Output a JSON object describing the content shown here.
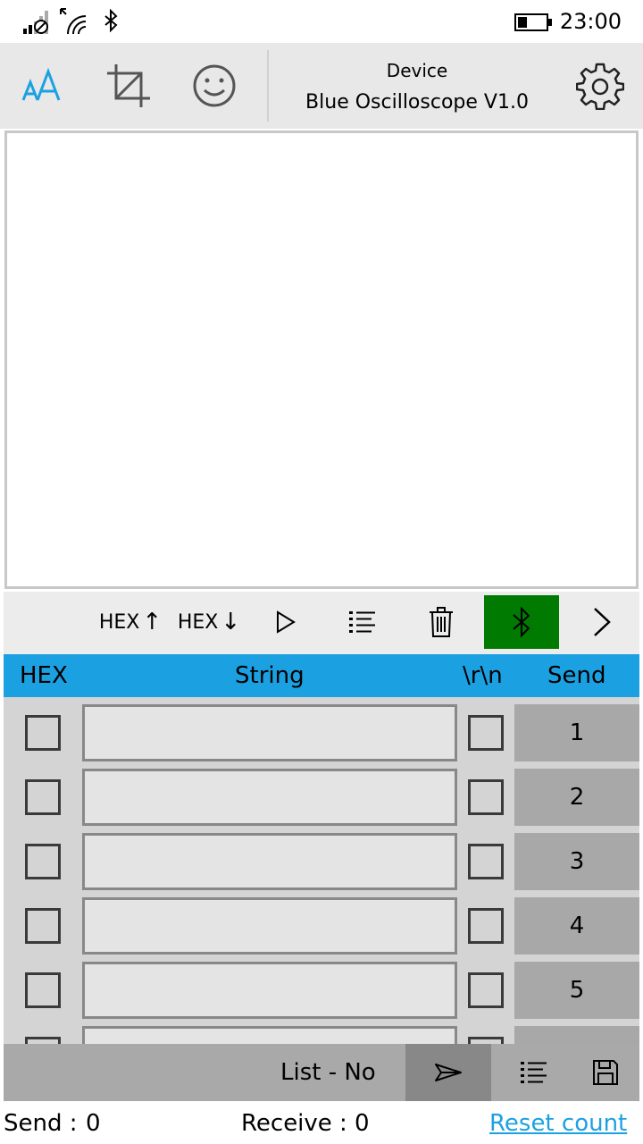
{
  "status_bar": {
    "time": "23:00",
    "icons": [
      "signal-off-icon",
      "data-arrows-icon",
      "wifi-icon",
      "bluetooth-icon",
      "battery-icon"
    ]
  },
  "app_bar": {
    "icons": [
      "font-size-icon",
      "crop-icon",
      "emoji-icon",
      "settings-gear-icon"
    ],
    "device_caption": "Device",
    "device_name": "Blue Oscilloscope V1.0"
  },
  "mid_bar": {
    "hex_up_label": "HEX",
    "hex_up_arrow": "↑",
    "hex_down_label": "HEX",
    "hex_down_arrow": "↓",
    "bluetooth_active_color": "#007a00",
    "icons": [
      "play-icon",
      "list-icon",
      "trash-icon",
      "bluetooth-icon",
      "chevron-right-icon"
    ]
  },
  "send_header": {
    "hex": "HEX",
    "string": "String",
    "crlf": "\\r\\n",
    "send": "Send",
    "color": "#1ba1e2"
  },
  "send_rows": [
    {
      "send_label": "1",
      "hex_checked": false,
      "crlf_checked": false,
      "string_value": ""
    },
    {
      "send_label": "2",
      "hex_checked": false,
      "crlf_checked": false,
      "string_value": ""
    },
    {
      "send_label": "3",
      "hex_checked": false,
      "crlf_checked": false,
      "string_value": ""
    },
    {
      "send_label": "4",
      "hex_checked": false,
      "crlf_checked": false,
      "string_value": ""
    },
    {
      "send_label": "5",
      "hex_checked": false,
      "crlf_checked": false,
      "string_value": ""
    },
    {
      "send_label": "",
      "hex_checked": false,
      "crlf_checked": false,
      "string_value": ""
    }
  ],
  "bottom_bar": {
    "list_status": "List - No",
    "icons": [
      "send-arrow-icon",
      "list-icon",
      "save-icon"
    ]
  },
  "counts": {
    "send_label": "Send :",
    "send_value": "0",
    "receive_label": "Receive :",
    "receive_value": "0",
    "reset_label": "Reset count"
  }
}
